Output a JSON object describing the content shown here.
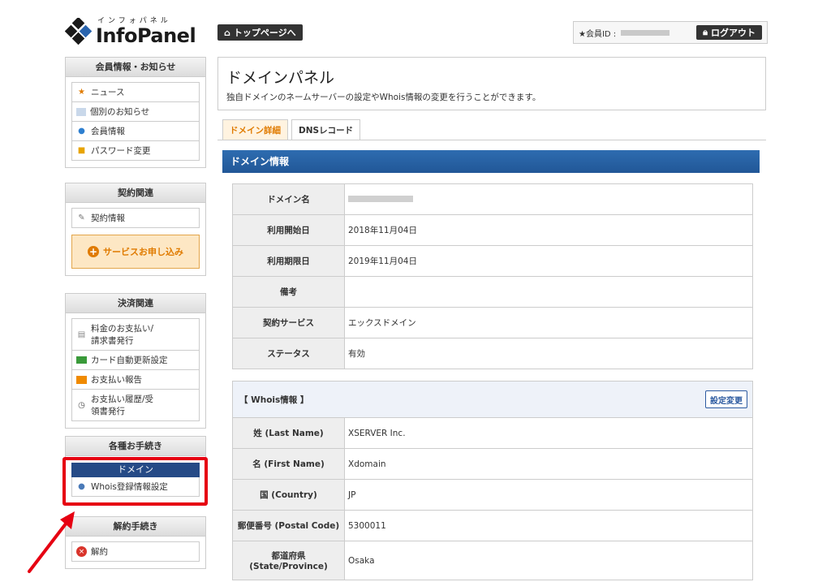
{
  "header": {
    "logo_kana": "インフォパネル",
    "logo_text": "InfoPanel",
    "top_button": "トップページへ",
    "member_id_label": "★会員ID :",
    "logout_button": "ログアウト"
  },
  "sidebar": {
    "member": {
      "title": "会員情報・お知らせ",
      "items": [
        "ニュース",
        "個別のお知らせ",
        "会員情報",
        "パスワード変更"
      ]
    },
    "contract": {
      "title": "契約関連",
      "items": [
        "契約情報"
      ],
      "service_button": "サービスお申し込み"
    },
    "payment": {
      "title": "決済関連",
      "items": [
        "料金のお支払い/請求書発行",
        "カード自動更新設定",
        "お支払い報告",
        "お支払い履歴/受領書発行"
      ]
    },
    "procedures": {
      "title": "各種お手続き",
      "domain_header": "ドメイン",
      "items": [
        "Whois登録情報設定"
      ]
    },
    "cancel": {
      "title": "解約手続き",
      "items": [
        "解約"
      ]
    }
  },
  "main": {
    "title": "ドメインパネル",
    "description": "独自ドメインのネームサーバーの設定やWhois情報の変更を行うことができます。",
    "tabs": [
      "ドメイン詳細",
      "DNSレコード"
    ],
    "section_title": "ドメイン情報",
    "domain_rows": [
      {
        "label": "ドメイン名",
        "value": ""
      },
      {
        "label": "利用開始日",
        "value": "2018年11月04日"
      },
      {
        "label": "利用期限日",
        "value": "2019年11月04日"
      },
      {
        "label": "備考",
        "value": ""
      },
      {
        "label": "契約サービス",
        "value": "エックスドメイン"
      },
      {
        "label": "ステータス",
        "value": "有効"
      }
    ],
    "whois_title": "【 Whois情報 】",
    "whois_edit_button": "設定変更",
    "whois_rows": [
      {
        "label": "姓 (Last Name)",
        "value": "XSERVER Inc."
      },
      {
        "label": "名 (First Name)",
        "value": "Xdomain"
      },
      {
        "label": "国 (Country)",
        "value": "JP"
      },
      {
        "label": "郵便番号 (Postal Code)",
        "value": "5300011"
      },
      {
        "label": "都道府県 (State/Province)",
        "value": "Osaka"
      }
    ]
  },
  "colors": {
    "accent_orange": "#e07b00",
    "section_blue": "#2566a8",
    "domain_navy": "#254a86",
    "highlight_red": "#e60012"
  }
}
